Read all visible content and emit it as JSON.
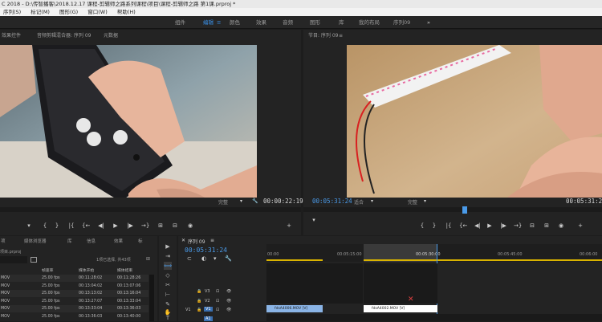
{
  "window": {
    "title": "C 2018 - D:\\传智播客\\2018.12.17 课程-剪辑师之路系列课程\\项目\\课程-剪辑师之路 第1课.prproj *"
  },
  "menu": {
    "items": [
      "序列(S)",
      "标记(M)",
      "图形(G)",
      "窗口(W)",
      "帮助(H)"
    ]
  },
  "workspaces": {
    "items": [
      "组件",
      "编辑",
      "颜色",
      "效果",
      "音频",
      "图形",
      "库",
      "我的布局",
      "序列09"
    ],
    "active_marker": "≡",
    "more": "»"
  },
  "source_panel": {
    "tabs": [
      "效果控件",
      "音频剪辑混合器: 序列 09",
      "元数据"
    ],
    "fit": "完整",
    "timecode_right": "00:00:22:19"
  },
  "program_panel": {
    "tab": "节目: 序列 09",
    "menu": "≡",
    "timecode_left": "00:05:31:24",
    "fit": "适合",
    "quality": "完整",
    "timecode_right": "00:05:31:24"
  },
  "transport": {
    "source": [
      "▾",
      "{",
      "}",
      "|{",
      "{←",
      "◀|",
      "▶",
      "|▶",
      "→}",
      "⊞",
      "⊟",
      "◉",
      "+"
    ],
    "program": [
      "▾",
      "{",
      "}",
      "|{",
      "{←",
      "◀|",
      "▶",
      "|▶",
      "→}",
      "⊟",
      "⊞",
      "◉",
      "+"
    ]
  },
  "project_panel": {
    "tabs": [
      "项",
      "媒体浏览器",
      "库",
      "信息",
      "效果",
      "标"
    ],
    "name_field": "项目.prproj",
    "count": "1项已选择, 共43项",
    "columns": [
      "帧速率",
      "媒体开始",
      "媒体结束"
    ],
    "rows": [
      {
        "name": "MOV",
        "fps": "25.00 fps",
        "start": "00:11:28:02",
        "end": "00:11:28:26"
      },
      {
        "name": "MOV",
        "fps": "25.00 fps",
        "start": "00:13:04:02",
        "end": "00:13:07:06"
      },
      {
        "name": "MOV",
        "fps": "25.00 fps",
        "start": "00:13:13:02",
        "end": "00:13:16:04"
      },
      {
        "name": "MOV",
        "fps": "25.00 fps",
        "start": "00:13:27:07",
        "end": "00:13:33:04"
      },
      {
        "name": "MOV",
        "fps": "25.00 fps",
        "start": "00:13:33:04",
        "end": "00:13:36:03"
      },
      {
        "name": "MOV",
        "fps": "25.00 fps",
        "start": "00:13:36:03",
        "end": "00:13:40:00"
      }
    ]
  },
  "tools": {
    "items": [
      "▶",
      "⇥",
      "⟺",
      "◇",
      "✂",
      "⊢",
      "✎",
      "✋",
      "T"
    ],
    "selected_index": 2
  },
  "timeline": {
    "tab": "序列 09",
    "menu": "≡",
    "timecode": "00:05:31:24",
    "ruler": [
      "00:00",
      "00:05:15:00",
      "00:05:30:00",
      "00:05:45:00",
      "00:06:00"
    ],
    "tracks": [
      "V3",
      "V2",
      "V1",
      "A1"
    ],
    "track_icons": [
      "🔒",
      "⊡",
      "👁"
    ],
    "clips": [
      {
        "label": "fdsA4006.MOV [V]",
        "color": "#8ab4e6"
      },
      {
        "label": "fdsA4002.MOV [V]",
        "color": "#ffffff"
      }
    ],
    "transition_icon": "✕"
  },
  "colors": {
    "accent": "#4a9ae8",
    "panel": "#232323",
    "background": "#1d1d1d"
  }
}
